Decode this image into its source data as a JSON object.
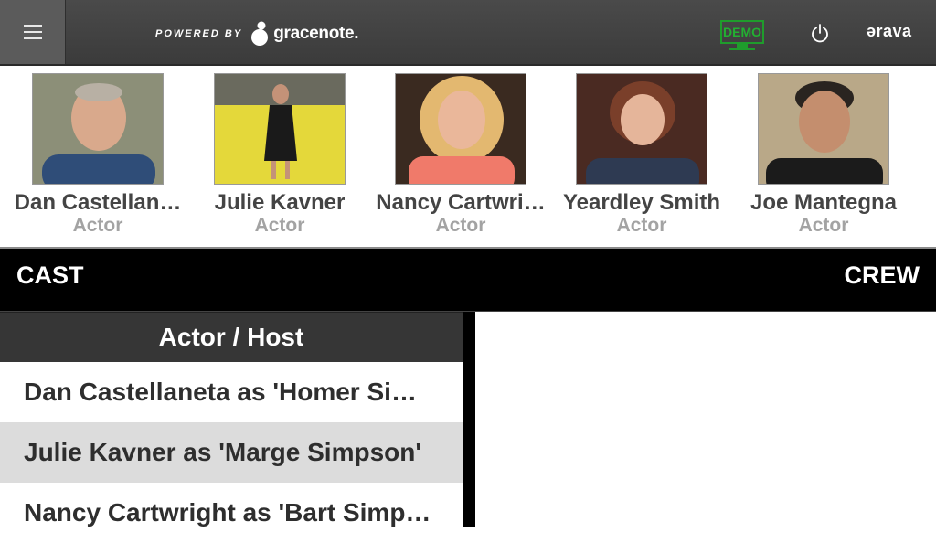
{
  "header": {
    "powered_by": "POWERED BY",
    "gracenote": "gracenote.",
    "demo_label": "DEMO",
    "brand": "ərava",
    "colors": {
      "bar": "#3e3e3e",
      "demo_green": "#22b031"
    }
  },
  "cast": [
    {
      "name": "Dan Castellan…",
      "role": "Actor"
    },
    {
      "name": "Julie Kavner",
      "role": "Actor"
    },
    {
      "name": "Nancy Cartwri…",
      "role": "Actor"
    },
    {
      "name": "Yeardley Smith",
      "role": "Actor"
    },
    {
      "name": "Joe Mantegna",
      "role": "Actor"
    }
  ],
  "tabs": {
    "cast": "CAST",
    "crew": "CREW"
  },
  "list": {
    "heading": "Actor / Host",
    "rows": [
      "Dan Castellaneta as 'Homer Sim…",
      "Julie Kavner as 'Marge Simpson'",
      "Nancy Cartwright as 'Bart Simp…"
    ]
  }
}
